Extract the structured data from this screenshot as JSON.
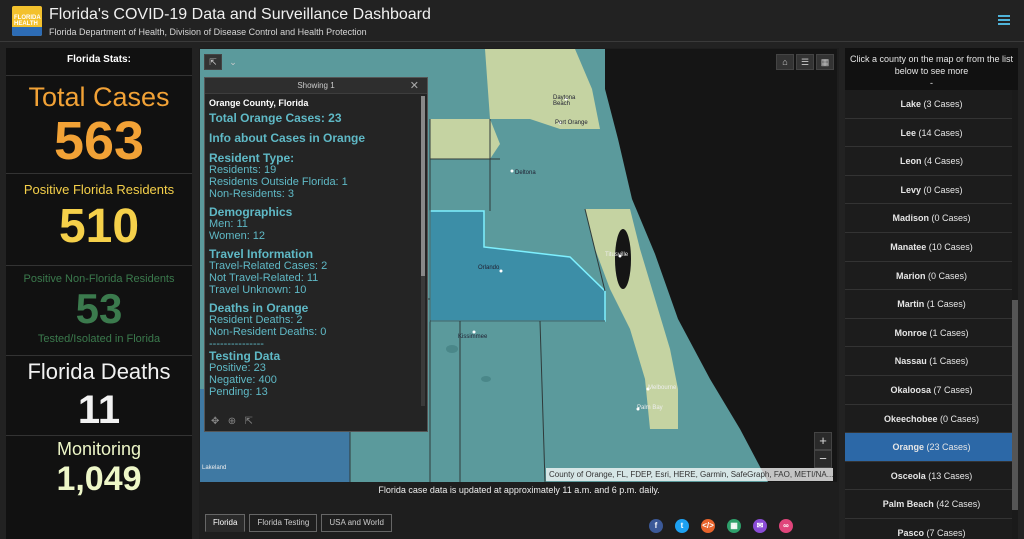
{
  "header": {
    "title": "Florida's COVID-19 Data and Surveillance Dashboard",
    "subtitle": "Florida Department of Health, Division of Disease Control and Health Protection",
    "logo_text": "FLORIDA HEALTH"
  },
  "stats": {
    "heading": "Florida Stats:",
    "total_cases_label": "Total Cases",
    "total_cases_value": "563",
    "residents_label": "Positive Florida Residents",
    "residents_value": "510",
    "nonresidents_label": "Positive Non-Florida Residents",
    "nonresidents_value": "53",
    "nonresidents_sub": "Tested/Isolated in Florida",
    "deaths_label": "Florida Deaths",
    "deaths_value": "11",
    "monitoring_label": "Monitoring",
    "monitoring_value": "1,049"
  },
  "map": {
    "labels": {
      "orlando": "Orlando",
      "kissimmee": "Kissimmee",
      "titusville": "Titusville",
      "melbourne": "Melbourne",
      "palm_bay": "Palm Bay",
      "daytona": "Daytona Beach",
      "port_orange": "Port Orange",
      "deltona": "Deltona",
      "lakeland": "Lakeland"
    },
    "attribution": "County of Orange, FL, FDEP, Esri, HERE, Garmin, SafeGraph, FAO, METI/NA...",
    "zoom_in": "+",
    "zoom_out": "−"
  },
  "popup": {
    "header": "Showing 1",
    "close": "✕",
    "county": "Orange County, Florida",
    "total": "Total Orange Cases: 23",
    "info": "Info about Cases in Orange",
    "resident_type_heading": "Resident Type:",
    "residents": "Residents: 19",
    "residents_outside": "Residents Outside Florida: 1",
    "non_residents": "Non-Residents: 3",
    "demographics_heading": "Demographics",
    "men": "Men: 11",
    "women": "Women: 12",
    "travel_heading": "Travel Information",
    "travel_related": "Travel-Related Cases: 2",
    "not_travel": "Not Travel-Related: 11",
    "travel_unknown": "Travel Unknown: 10",
    "deaths_heading": "Deaths in Orange",
    "resident_deaths": "Resident Deaths: 2",
    "nonresident_deaths": "Non-Resident Deaths: 0",
    "divider": "---------------",
    "testing_heading": "Testing Data",
    "positive": "Positive: 23",
    "negative": "Negative: 400",
    "pending": "Pending: 13"
  },
  "footer": {
    "updated": "Florida case data is updated at approximately 11 a.m. and 6 p.m. daily.",
    "tabs": [
      "Florida",
      "Florida Testing",
      "USA and World"
    ]
  },
  "county_list": {
    "heading": "Click a county on the map or from the list below to see more",
    "dash": "-",
    "items": [
      {
        "name": "Lake",
        "count": "(3 Cases)"
      },
      {
        "name": "Lee",
        "count": "(14 Cases)"
      },
      {
        "name": "Leon",
        "count": "(4 Cases)"
      },
      {
        "name": "Levy",
        "count": "(0 Cases)"
      },
      {
        "name": "Madison",
        "count": "(0 Cases)"
      },
      {
        "name": "Manatee",
        "count": "(10 Cases)"
      },
      {
        "name": "Marion",
        "count": "(0 Cases)"
      },
      {
        "name": "Martin",
        "count": "(1 Cases)"
      },
      {
        "name": "Monroe",
        "count": "(1 Cases)"
      },
      {
        "name": "Nassau",
        "count": "(1 Cases)"
      },
      {
        "name": "Okaloosa",
        "count": "(7 Cases)"
      },
      {
        "name": "Okeechobee",
        "count": "(0 Cases)"
      },
      {
        "name": "Orange",
        "count": "(23 Cases)"
      },
      {
        "name": "Osceola",
        "count": "(13 Cases)"
      },
      {
        "name": "Palm Beach",
        "count": "(42 Cases)"
      },
      {
        "name": "Pasco",
        "count": "(7 Cases)"
      }
    ],
    "selected": "Orange"
  },
  "colors": {
    "orange_stat": "#f2a236",
    "yellow_stat": "#f5d04a",
    "green_stat": "#3b7a4d",
    "selected_row": "#2c68a7",
    "popup_text": "#5fb9c6"
  }
}
